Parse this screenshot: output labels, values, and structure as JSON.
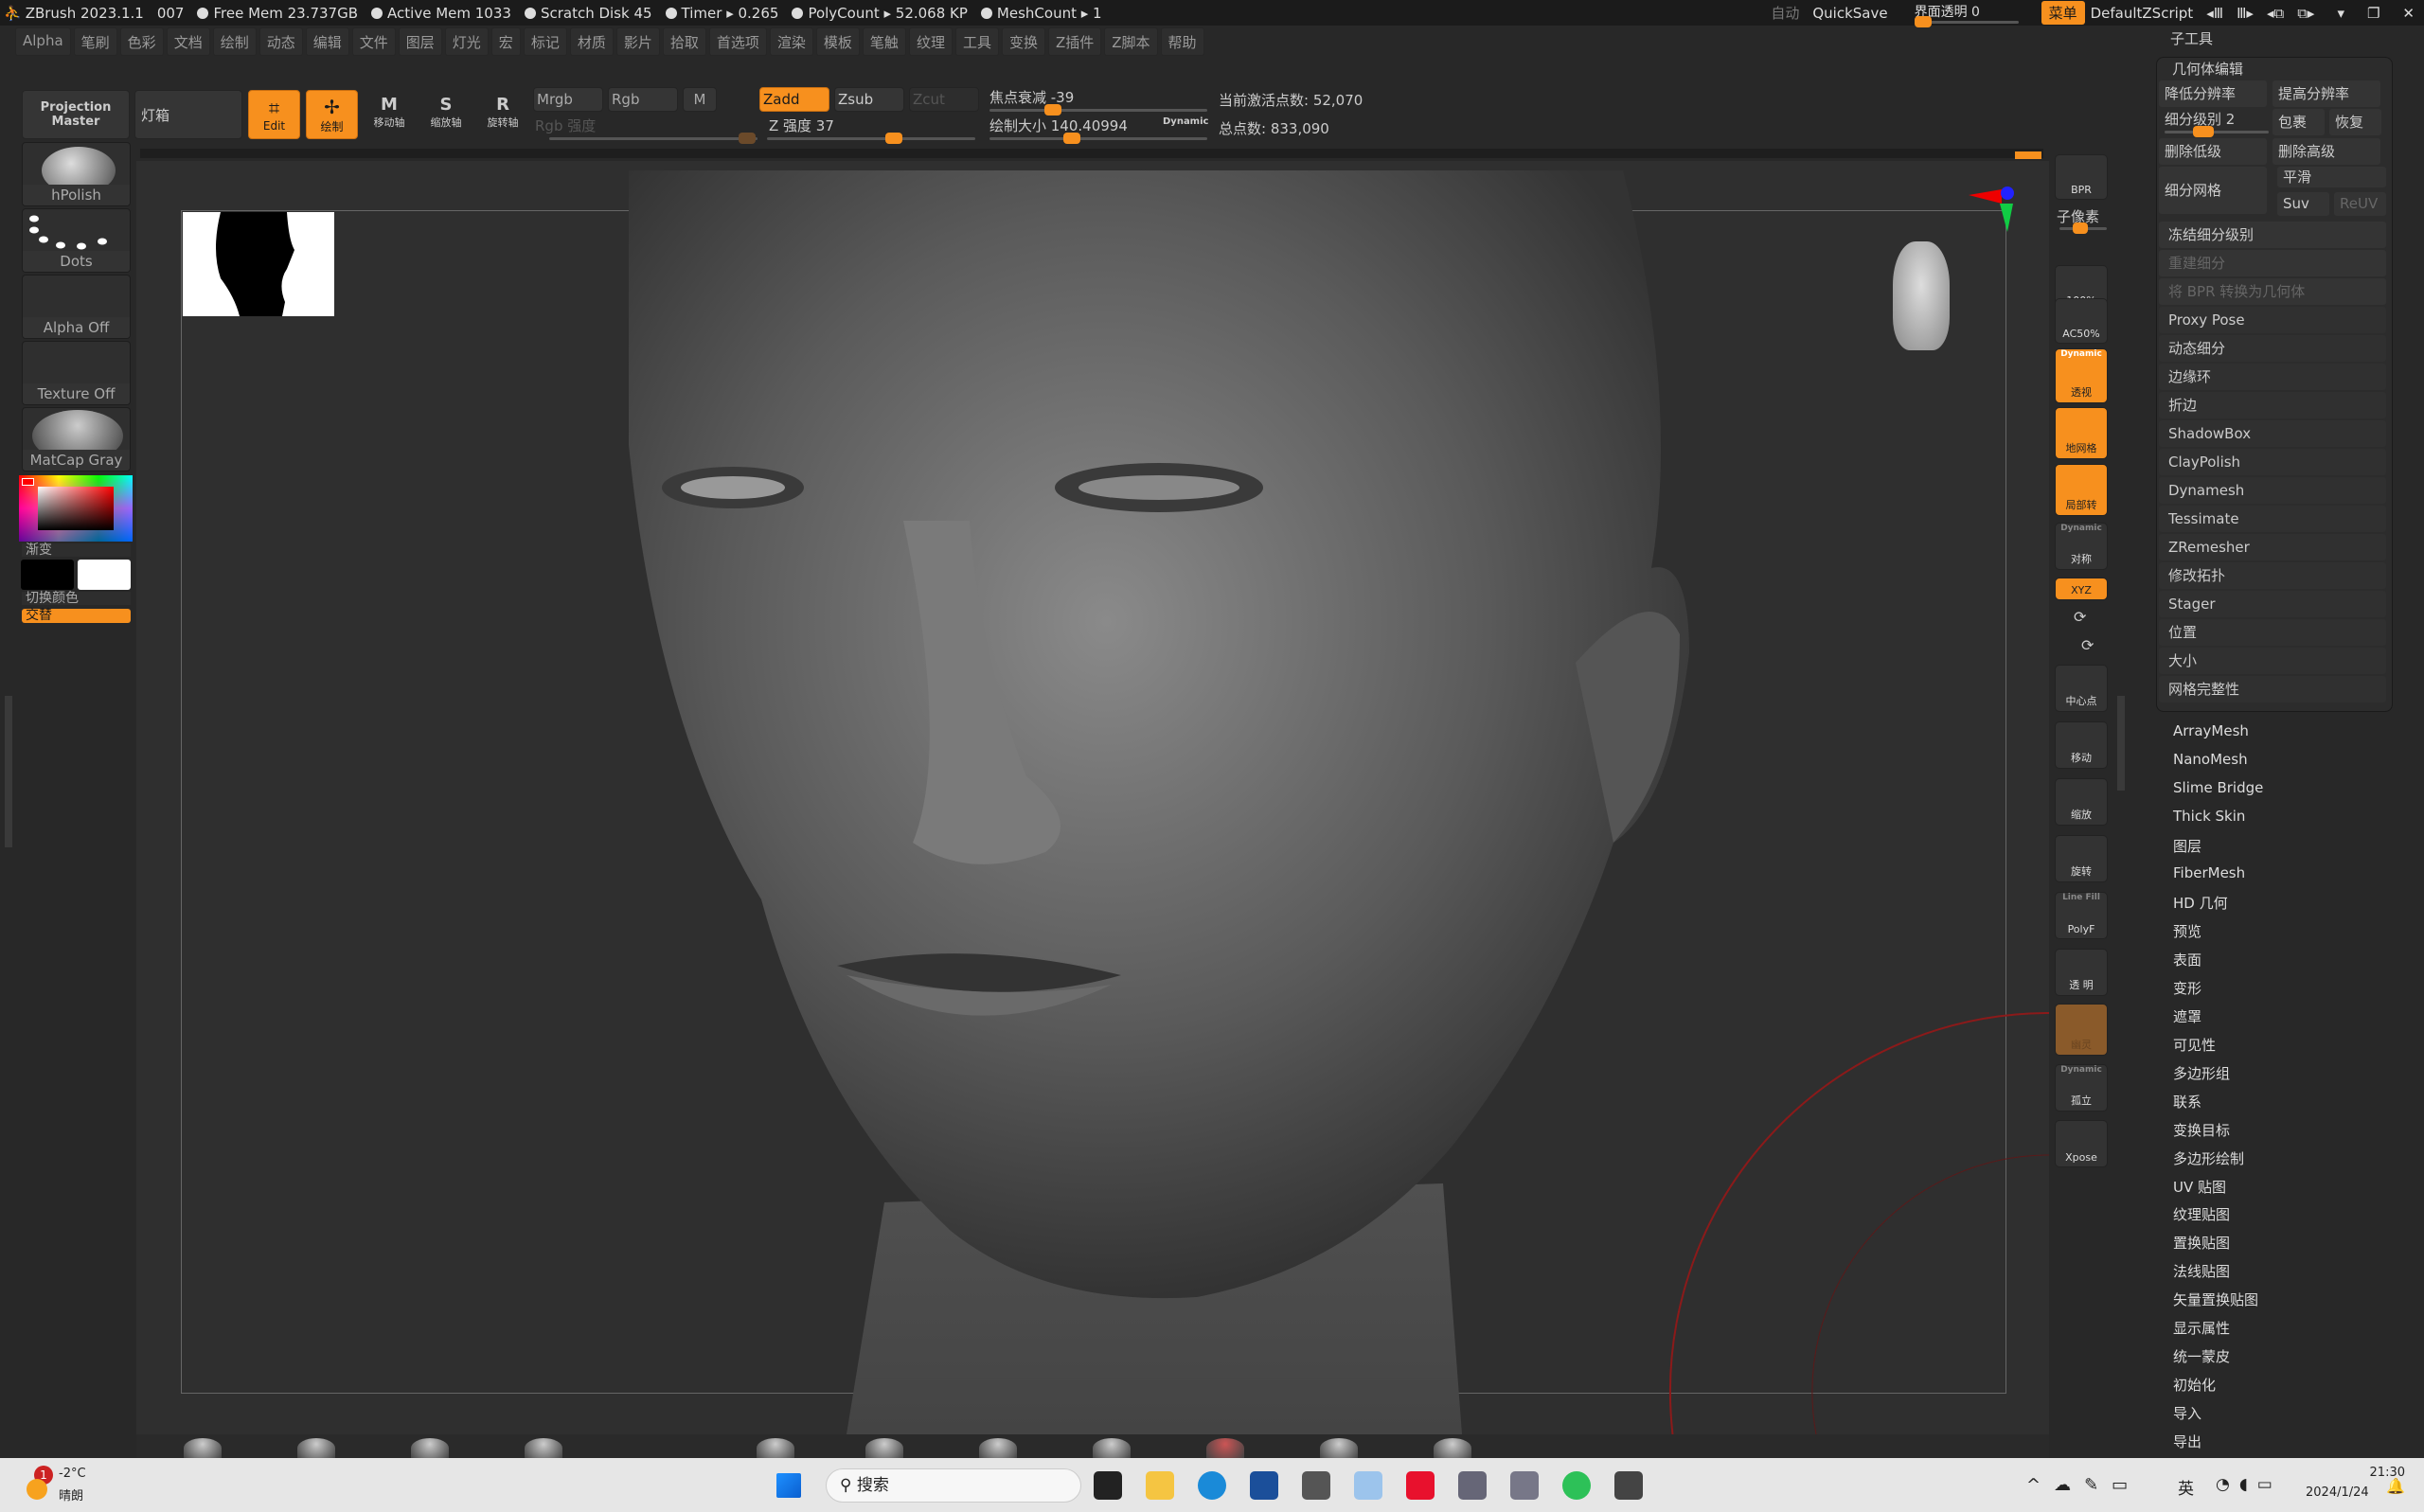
{
  "titlebar": {
    "app": "ZBrush 2023.1.1",
    "code": "007",
    "stats": [
      "Free Mem 23.737GB",
      "Active Mem 1033",
      "Scratch Disk 45",
      "Timer ▸ 0.265",
      "PolyCount ▸ 52.068 KP",
      "MeshCount ▸ 1"
    ],
    "auto": "自动",
    "quicksave": "QuickSave",
    "ui_transparency": "界面透明 0",
    "ui_transparency_value": 0,
    "menu": "菜单",
    "script": "DefaultZScript"
  },
  "menu": [
    "Alpha",
    "笔刷",
    "色彩",
    "文档",
    "绘制",
    "动态",
    "编辑",
    "文件",
    "图层",
    "灯光",
    "宏",
    "标记",
    "材质",
    "影片",
    "拾取",
    "首选项",
    "渲染",
    "模板",
    "笔触",
    "纹理",
    "工具",
    "变换",
    "Z插件",
    "Z脚本",
    "帮助"
  ],
  "toolbar": {
    "projection_master": "Projection Master",
    "lightbox": "灯箱",
    "edit": "Edit",
    "draw": "绘制",
    "move": "移动轴",
    "scale": "缩放轴",
    "rotate": "旋转轴",
    "mrgb": "Mrgb",
    "rgb": "Rgb",
    "m": "M",
    "rgb_intensity": "Rgb 强度",
    "zadd": "Zadd",
    "zsub": "Zsub",
    "zcut": "Zcut",
    "z_intensity": "Z 强度 37",
    "z_intensity_value": 37,
    "focal": "焦点衰减 -39",
    "focal_value": -39,
    "draw_size": "绘制大小 140.40994",
    "draw_size_value": 140.40994,
    "dynamic": "Dynamic",
    "active_points": "当前激活点数: 52,070",
    "total_points": "总点数: 833,090"
  },
  "left": {
    "brush": "hPolish",
    "stroke": "Dots",
    "alpha": "Alpha Off",
    "texture": "Texture Off",
    "material": "MatCap Gray",
    "gradient": "渐变",
    "switch_color": "切换颜色",
    "alternate": "交替",
    "colors": {
      "main": "#000000",
      "secondary": "#ffffff",
      "picked": "#ff0000"
    }
  },
  "right_icons": [
    {
      "label": "BPR",
      "state": "normal"
    },
    {
      "label": "100%",
      "state": "normal"
    },
    {
      "label": "AC50%",
      "state": "normal"
    },
    {
      "label": "透视",
      "top": "Dynamic",
      "state": "on"
    },
    {
      "label": "地网格",
      "state": "on"
    },
    {
      "label": "局部转",
      "state": "on"
    },
    {
      "label": "对称",
      "top": "Dynamic",
      "state": "normal"
    },
    {
      "label": "XYZ",
      "state": "on"
    },
    {
      "label": "中心点",
      "state": "normal"
    },
    {
      "label": "移动",
      "state": "normal"
    },
    {
      "label": "缩放",
      "state": "normal"
    },
    {
      "label": "旋转",
      "state": "normal"
    },
    {
      "label": "PolyF",
      "top": "Line Fill",
      "state": "normal"
    },
    {
      "label": "透 明",
      "state": "normal"
    },
    {
      "label": "幽灵",
      "state": "dim"
    },
    {
      "label": "孤立",
      "top": "Dynamic",
      "state": "normal"
    },
    {
      "label": "Xpose",
      "state": "normal"
    }
  ],
  "subpixel": "子像素",
  "right_panel": {
    "subtool": "子工具",
    "geometry": "几何体编辑",
    "lower_res": "降低分辨率",
    "higher_res": "提高分辨率",
    "subdiv_level": "细分级别 2",
    "subdiv_value": 2,
    "wrap": "包裹",
    "restore": "恢复",
    "del_lower": "删除低级",
    "del_higher": "删除高级",
    "divide": "细分网格",
    "smooth": "平滑",
    "suv": "Suv",
    "reuv": "ReUV",
    "freeze": "冻结细分级别",
    "rebuild": "重建细分",
    "bpr_convert": "将 BPR 转换为几何体",
    "items": [
      "Proxy Pose",
      "动态细分",
      "边缘环",
      "折边",
      "ShadowBox",
      "ClayPolish",
      "Dynamesh",
      "Tessimate",
      "ZRemesher",
      "修改拓扑",
      "Stager",
      "位置",
      "大小",
      "网格完整性"
    ],
    "sections": [
      "ArrayMesh",
      "NanoMesh",
      "Slime Bridge",
      "Thick Skin",
      "图层",
      "FiberMesh",
      "HD 几何",
      "预览",
      "表面",
      "变形",
      "遮罩",
      "可见性",
      "多边形组",
      "联系",
      "变换目标",
      "多边形绘制",
      "UV 贴图",
      "纹理贴图",
      "置换贴图",
      "法线贴图",
      "矢量置换贴图",
      "显示属性",
      "统一蒙皮",
      "初始化",
      "导入",
      "导出"
    ]
  },
  "taskbar": {
    "temp": "-2°C",
    "weather": "晴朗",
    "badge": "1",
    "search": "搜索",
    "ime": "英",
    "time": "21:30",
    "date": "2024/1/24"
  },
  "accent": "#f7901e"
}
